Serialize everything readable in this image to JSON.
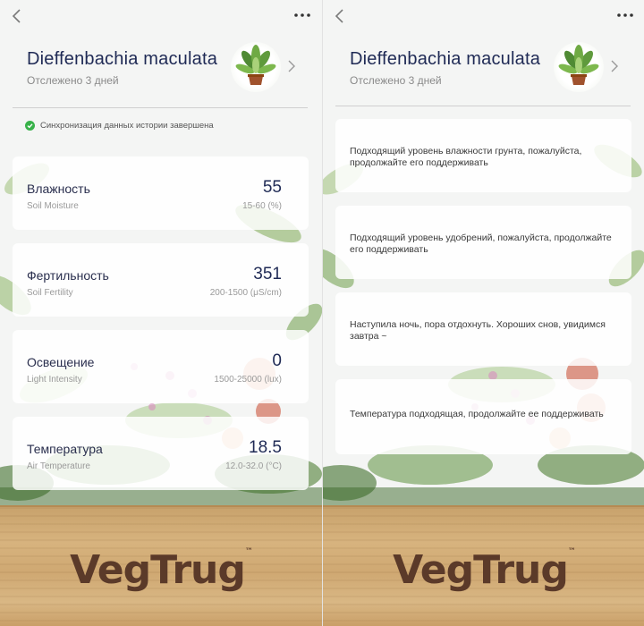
{
  "plant": {
    "name": "Dieffenbachia maculata",
    "tracked": "Отслежено 3 дней"
  },
  "sync": {
    "text": "Синхронизация данных истории завершена"
  },
  "metrics": [
    {
      "title": "Влажность",
      "subtitle": "Soil Moisture",
      "value": "55",
      "range": "15-60 (%)"
    },
    {
      "title": "Фертильность",
      "subtitle": "Soil Fertility",
      "value": "351",
      "range": "200-1500 (μS/cm)"
    },
    {
      "title": "Освещение",
      "subtitle": "Light Intensity",
      "value": "0",
      "range": "1500-25000 (lux)"
    },
    {
      "title": "Температура",
      "subtitle": "Air Temperature",
      "value": "18.5",
      "range": "12.0-32.0 (°C)"
    }
  ],
  "advice": [
    {
      "text": "Подходящий уровень влажности грунта, пожалуйста, продолжайте его поддерживать"
    },
    {
      "text": "Подходящий уровень удобрений, пожалуйста, продолжайте его поддерживать"
    },
    {
      "text": "Наступила ночь, пора отдохнуть. Хороших снов, увидимся завтра ~"
    },
    {
      "text": "Температура подходящая, продолжайте ее поддерживать"
    }
  ],
  "brand": {
    "name": "VegTrug",
    "tm": "™"
  },
  "icons": {
    "back": "back-chevron-icon",
    "more": "more-dots-icon",
    "forward": "chevron-right-icon",
    "sync_ok": "check-circle-icon",
    "plant": "potted-plant-icon"
  },
  "colors": {
    "title": "#1f2a55",
    "sync_ok": "#38b24a",
    "wood": "#d7b37e",
    "brand": "#5b3a29"
  }
}
